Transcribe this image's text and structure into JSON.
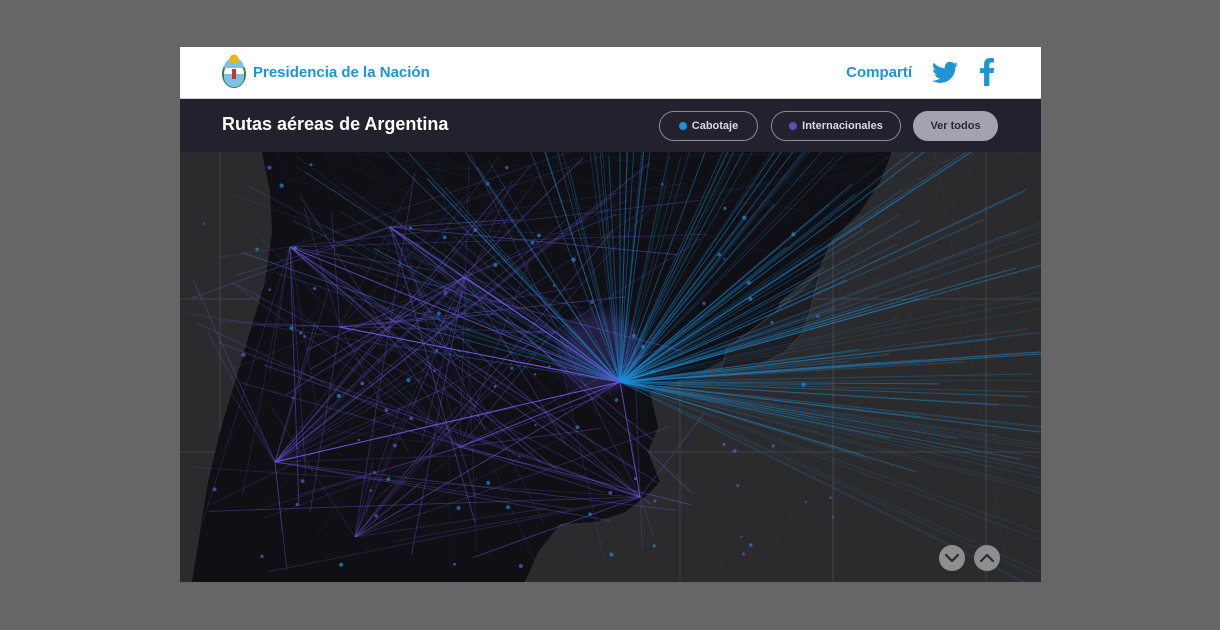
{
  "header": {
    "brand": "Presidencia de la Nación",
    "share_label": "Compartí",
    "social": [
      {
        "name": "twitter",
        "icon": "twitter-icon"
      },
      {
        "name": "facebook",
        "icon": "facebook-icon"
      }
    ],
    "logo_icon": "national-coat-of-arms-icon"
  },
  "subheader": {
    "title": "Rutas aéreas de Argentina",
    "filters": [
      {
        "label": "Cabotaje",
        "color": "#1e8fd6"
      },
      {
        "label": "Internacionales",
        "color": "#5c4fb8"
      },
      {
        "label": "Ver todos",
        "selected": true
      }
    ]
  },
  "map": {
    "background": "#2b2b2d",
    "land_color": "#0f0f14",
    "domestic_color": "#1e8fd6",
    "international_color": "#6a55d6"
  },
  "nav_buttons": [
    {
      "icon": "chevron-down-icon"
    },
    {
      "icon": "chevron-up-icon"
    }
  ]
}
